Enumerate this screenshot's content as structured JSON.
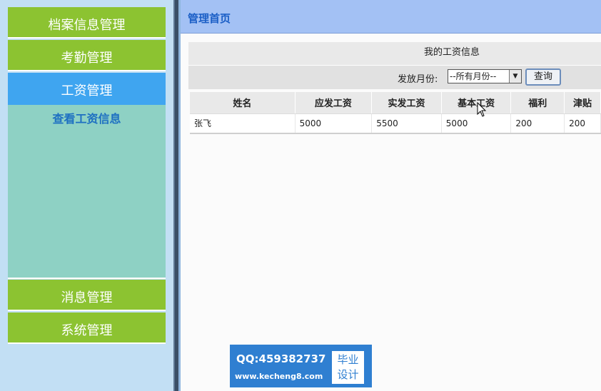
{
  "sidebar": {
    "items": [
      {
        "label": "档案信息管理"
      },
      {
        "label": "考勤管理"
      },
      {
        "label": "工资管理"
      },
      {
        "label": "消息管理"
      },
      {
        "label": "系统管理"
      }
    ],
    "submenu": {
      "label": "查看工资信息"
    }
  },
  "header": {
    "title": "管理首页"
  },
  "panel": {
    "title": "我的工资信息",
    "filter": {
      "label": "发放月份:",
      "month_value": "--所有月份--",
      "query_label": "查询"
    },
    "table": {
      "columns": [
        "姓名",
        "应发工资",
        "实发工资",
        "基本工资",
        "福利",
        "津贴"
      ],
      "rows": [
        [
          "张飞",
          "5000",
          "5500",
          "5000",
          "200",
          "200"
        ]
      ]
    }
  },
  "watermark": {
    "qq": "QQ:459382737",
    "site": "www.kecheng8.com",
    "badge_line1": "毕业",
    "badge_line2": "设计"
  },
  "colors": {
    "menu_green": "#8cc331",
    "menu_active_blue": "#3fa5f0",
    "submenu_teal": "#8ed1c4",
    "header_blue": "#a3c1f4",
    "link_blue": "#1d6fc2"
  },
  "icons": {
    "select_arrow": "chevron-down-icon",
    "cursor": "mouse-pointer-icon"
  }
}
